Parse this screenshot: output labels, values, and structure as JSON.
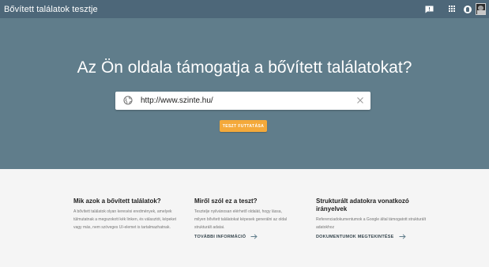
{
  "header": {
    "title": "Bővített találatok tesztje",
    "icons": [
      "feedback-icon",
      "apps-icon",
      "account-icon",
      "avatar"
    ]
  },
  "hero": {
    "headline": "Az Ön oldala támogatja a bővített találatokat?",
    "search": {
      "value": "http://www.szinte.hu/",
      "icon": "globe-icon",
      "clear_icon": "clear-icon"
    },
    "run_button": "TESZT FUTTATÁSA"
  },
  "info": {
    "columns": [
      {
        "heading": "Mik azok a bővített találatok?",
        "body": "A bővített találatok olyan keresési eredmények, amelyek túlmutatnak a megszokott kék linken, és választót, képeket vagy más, nem szöveges UI-elemet is tartalmazhatnak."
      },
      {
        "heading": "Miről szól ez a teszt?",
        "body": "Tesztelje nyilvánosan elérhető oldalát, hogy lássa, milyen bővített találatokat képesek generálni az oldal strukturált adatai.",
        "link": "TOVÁBBI INFORMÁCIÓ"
      },
      {
        "heading": "Strukturált adatokra vonatkozó irányelvek",
        "body": "Referenciadokumentumok a Google által támogatott strukturált adatokhoz",
        "link": "DOKUMENTUMOK MEGTEKINTÉSE"
      }
    ]
  },
  "colors": {
    "topbar": "#4d6779",
    "hero": "#607d8b",
    "accent": "#f4a93a",
    "page": "#f5f5f5"
  }
}
